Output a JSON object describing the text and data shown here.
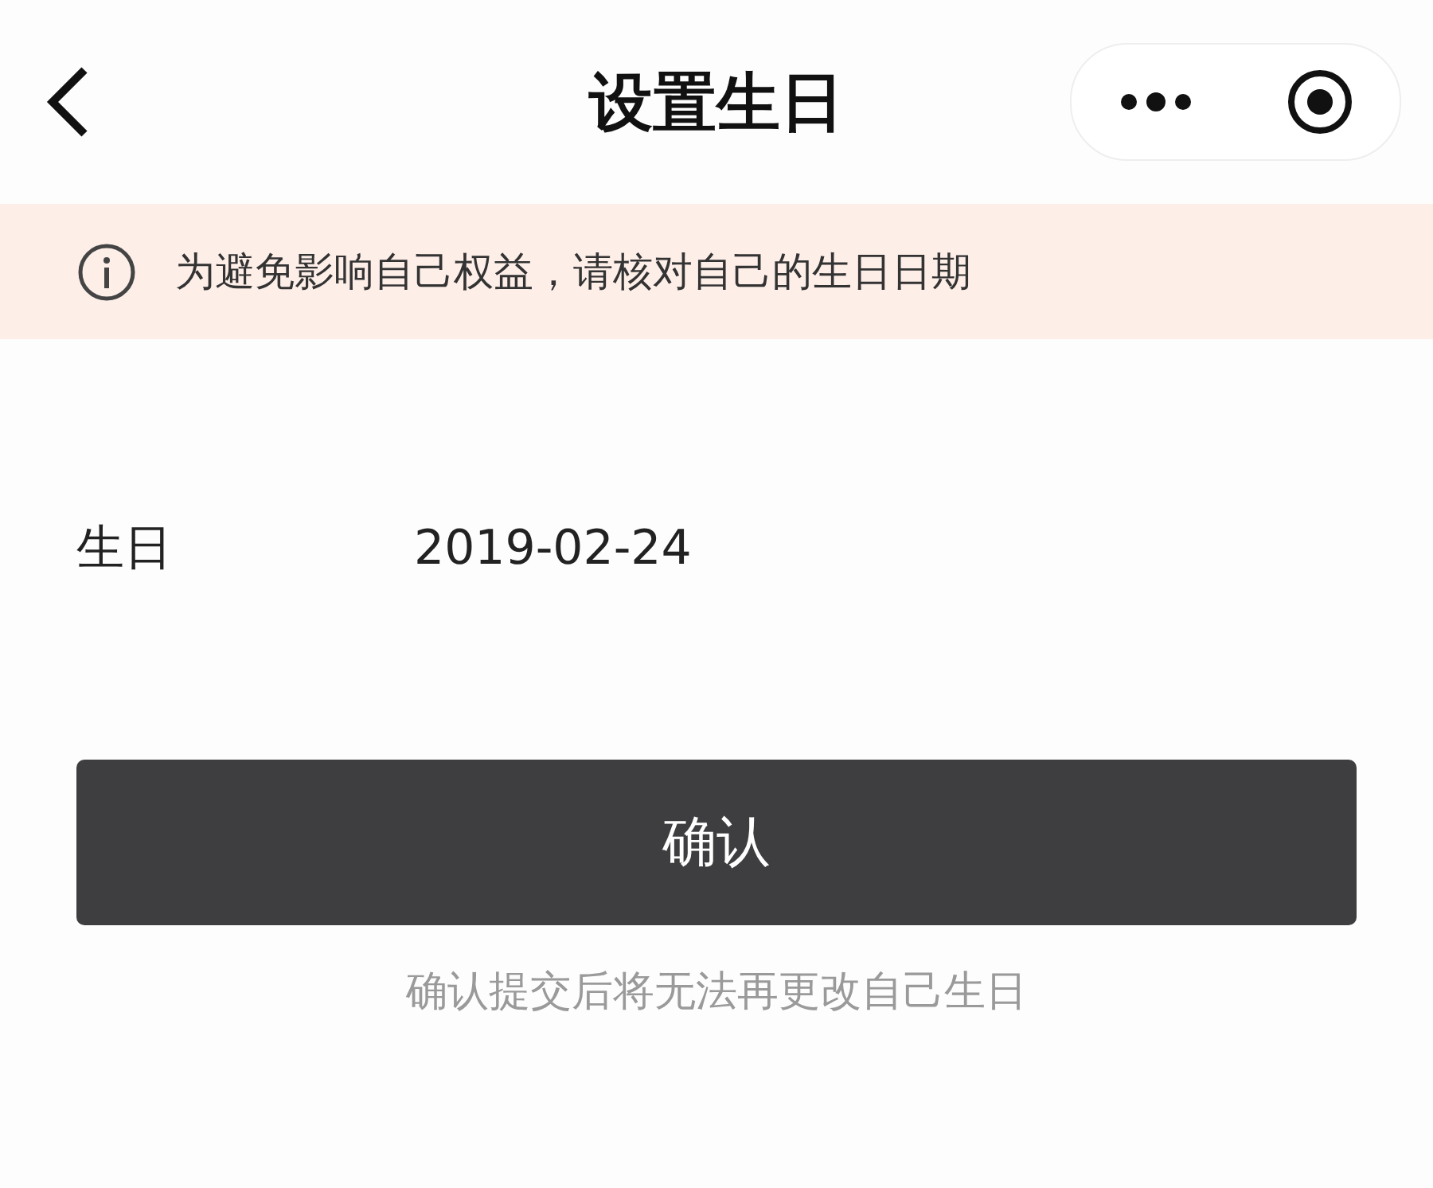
{
  "nav": {
    "title": "设置生日"
  },
  "notice": {
    "text": "为避免影响自己权益，请核对自己的生日日期"
  },
  "field": {
    "label": "生日",
    "value": "2019-02-24"
  },
  "confirm_button": {
    "label": "确认"
  },
  "hint": "确认提交后将无法再更改自己生日"
}
